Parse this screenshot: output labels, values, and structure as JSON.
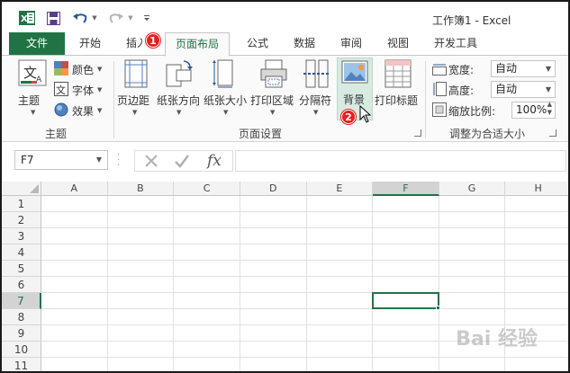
{
  "window": {
    "title": "工作簿1 - Excel"
  },
  "qat": {
    "app_icon": "excel-icon",
    "save_icon": "save-icon",
    "undo_icon": "undo-icon",
    "redo_icon": "redo-icon",
    "customize_icon": "customize-qat-icon"
  },
  "tabs": [
    {
      "label": "文件"
    },
    {
      "label": "开始"
    },
    {
      "label": "插入"
    },
    {
      "label": "页面布局"
    },
    {
      "label": "公式"
    },
    {
      "label": "数据"
    },
    {
      "label": "审阅"
    },
    {
      "label": "视图"
    },
    {
      "label": "开发工具"
    }
  ],
  "badges": {
    "one": "1",
    "two": "2"
  },
  "ribbon": {
    "themes_group": {
      "label": "主题",
      "themes_button": "主题",
      "colors": "颜色",
      "fonts": "字体",
      "effects": "效果"
    },
    "page_setup_group": {
      "label": "页面设置",
      "margins": "页边距",
      "orientation": "纸张方向",
      "size": "纸张大小",
      "print_area": "打印区域",
      "breaks": "分隔符",
      "background": "背景",
      "print_titles": "打印标题"
    },
    "scale_group": {
      "label": "调整为合适大小",
      "width_label": "宽度:",
      "width_value": "自动",
      "height_label": "高度:",
      "height_value": "自动",
      "scale_label": "缩放比例:",
      "scale_value": "100%"
    }
  },
  "formula_bar": {
    "name_box": "F7",
    "cancel_icon": "cancel-icon",
    "enter_icon": "check-icon",
    "fx_label": "fx",
    "content": ""
  },
  "sheet": {
    "columns": [
      "A",
      "B",
      "C",
      "D",
      "E",
      "F",
      "G",
      "H"
    ],
    "rows": [
      "1",
      "2",
      "3",
      "4",
      "5",
      "6",
      "7",
      "8",
      "9",
      "10",
      "11"
    ],
    "active_cell": "F7"
  },
  "watermark": "Bai 经验",
  "colors": {
    "excel_green": "#217346",
    "badge_red": "#e81d1d"
  }
}
